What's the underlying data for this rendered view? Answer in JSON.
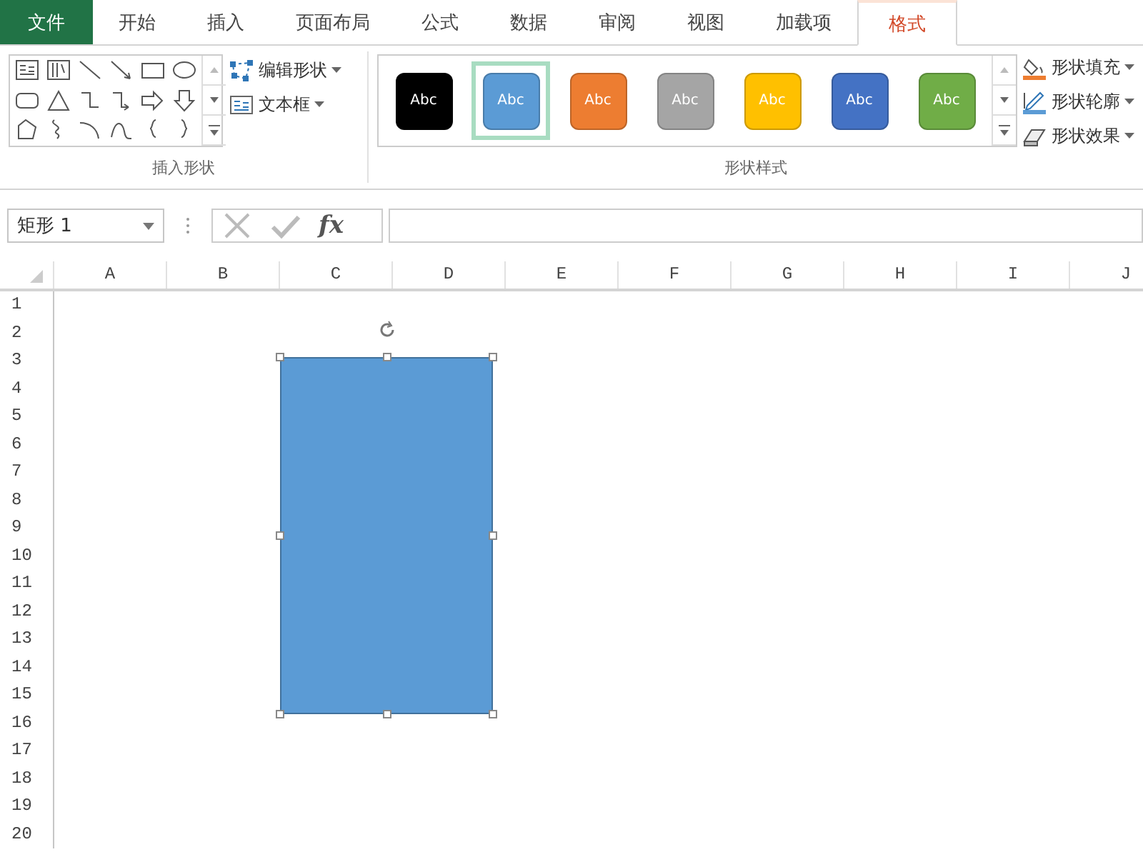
{
  "tabs": [
    {
      "label": "文件",
      "kind": "file",
      "selected": false
    },
    {
      "label": "开始",
      "kind": "normal",
      "selected": false
    },
    {
      "label": "插入",
      "kind": "normal",
      "selected": false
    },
    {
      "label": "页面布局",
      "kind": "normal",
      "selected": false
    },
    {
      "label": "公式",
      "kind": "normal",
      "selected": false
    },
    {
      "label": "数据",
      "kind": "normal",
      "selected": false
    },
    {
      "label": "审阅",
      "kind": "normal",
      "selected": false
    },
    {
      "label": "视图",
      "kind": "normal",
      "selected": false
    },
    {
      "label": "加载项",
      "kind": "normal",
      "selected": false
    },
    {
      "label": "格式",
      "kind": "normal",
      "selected": true
    }
  ],
  "insert_shapes": {
    "buttons": [
      {
        "label": "编辑形状",
        "kind": "edit"
      },
      {
        "label": "文本框",
        "kind": "textbox"
      }
    ],
    "group_label": "插入形状"
  },
  "shape_styles": {
    "styles": [
      {
        "label": "Abc",
        "color": "#000000",
        "selected": false
      },
      {
        "label": "Abc",
        "color": "#5b9bd5",
        "selected": true
      },
      {
        "label": "Abc",
        "color": "#ed7d31",
        "selected": false
      },
      {
        "label": "Abc",
        "color": "#a5a5a5",
        "selected": false
      },
      {
        "label": "Abc",
        "color": "#ffc000",
        "selected": false
      },
      {
        "label": "Abc",
        "color": "#4472c4",
        "selected": false
      },
      {
        "label": "Abc",
        "color": "#70ad47",
        "selected": false
      }
    ],
    "buttons": [
      {
        "label": "形状填充",
        "kind": "fill"
      },
      {
        "label": "形状轮廓",
        "kind": "outline"
      },
      {
        "label": "形状效果",
        "kind": "effect"
      }
    ],
    "group_label": "形状样式"
  },
  "formula_bar": {
    "name_box": "矩形 1",
    "fx": "fx"
  },
  "sheet": {
    "columns": [
      "A",
      "B",
      "C",
      "D",
      "E",
      "F",
      "G",
      "H",
      "I",
      "J"
    ],
    "rows": [
      "1",
      "2",
      "3",
      "4",
      "5",
      "6",
      "7",
      "8",
      "9",
      "10",
      "11",
      "12",
      "13",
      "14",
      "15",
      "16",
      "17",
      "18",
      "19",
      "20"
    ],
    "shape": {
      "color": "#5b9bd5",
      "selected": true
    }
  }
}
